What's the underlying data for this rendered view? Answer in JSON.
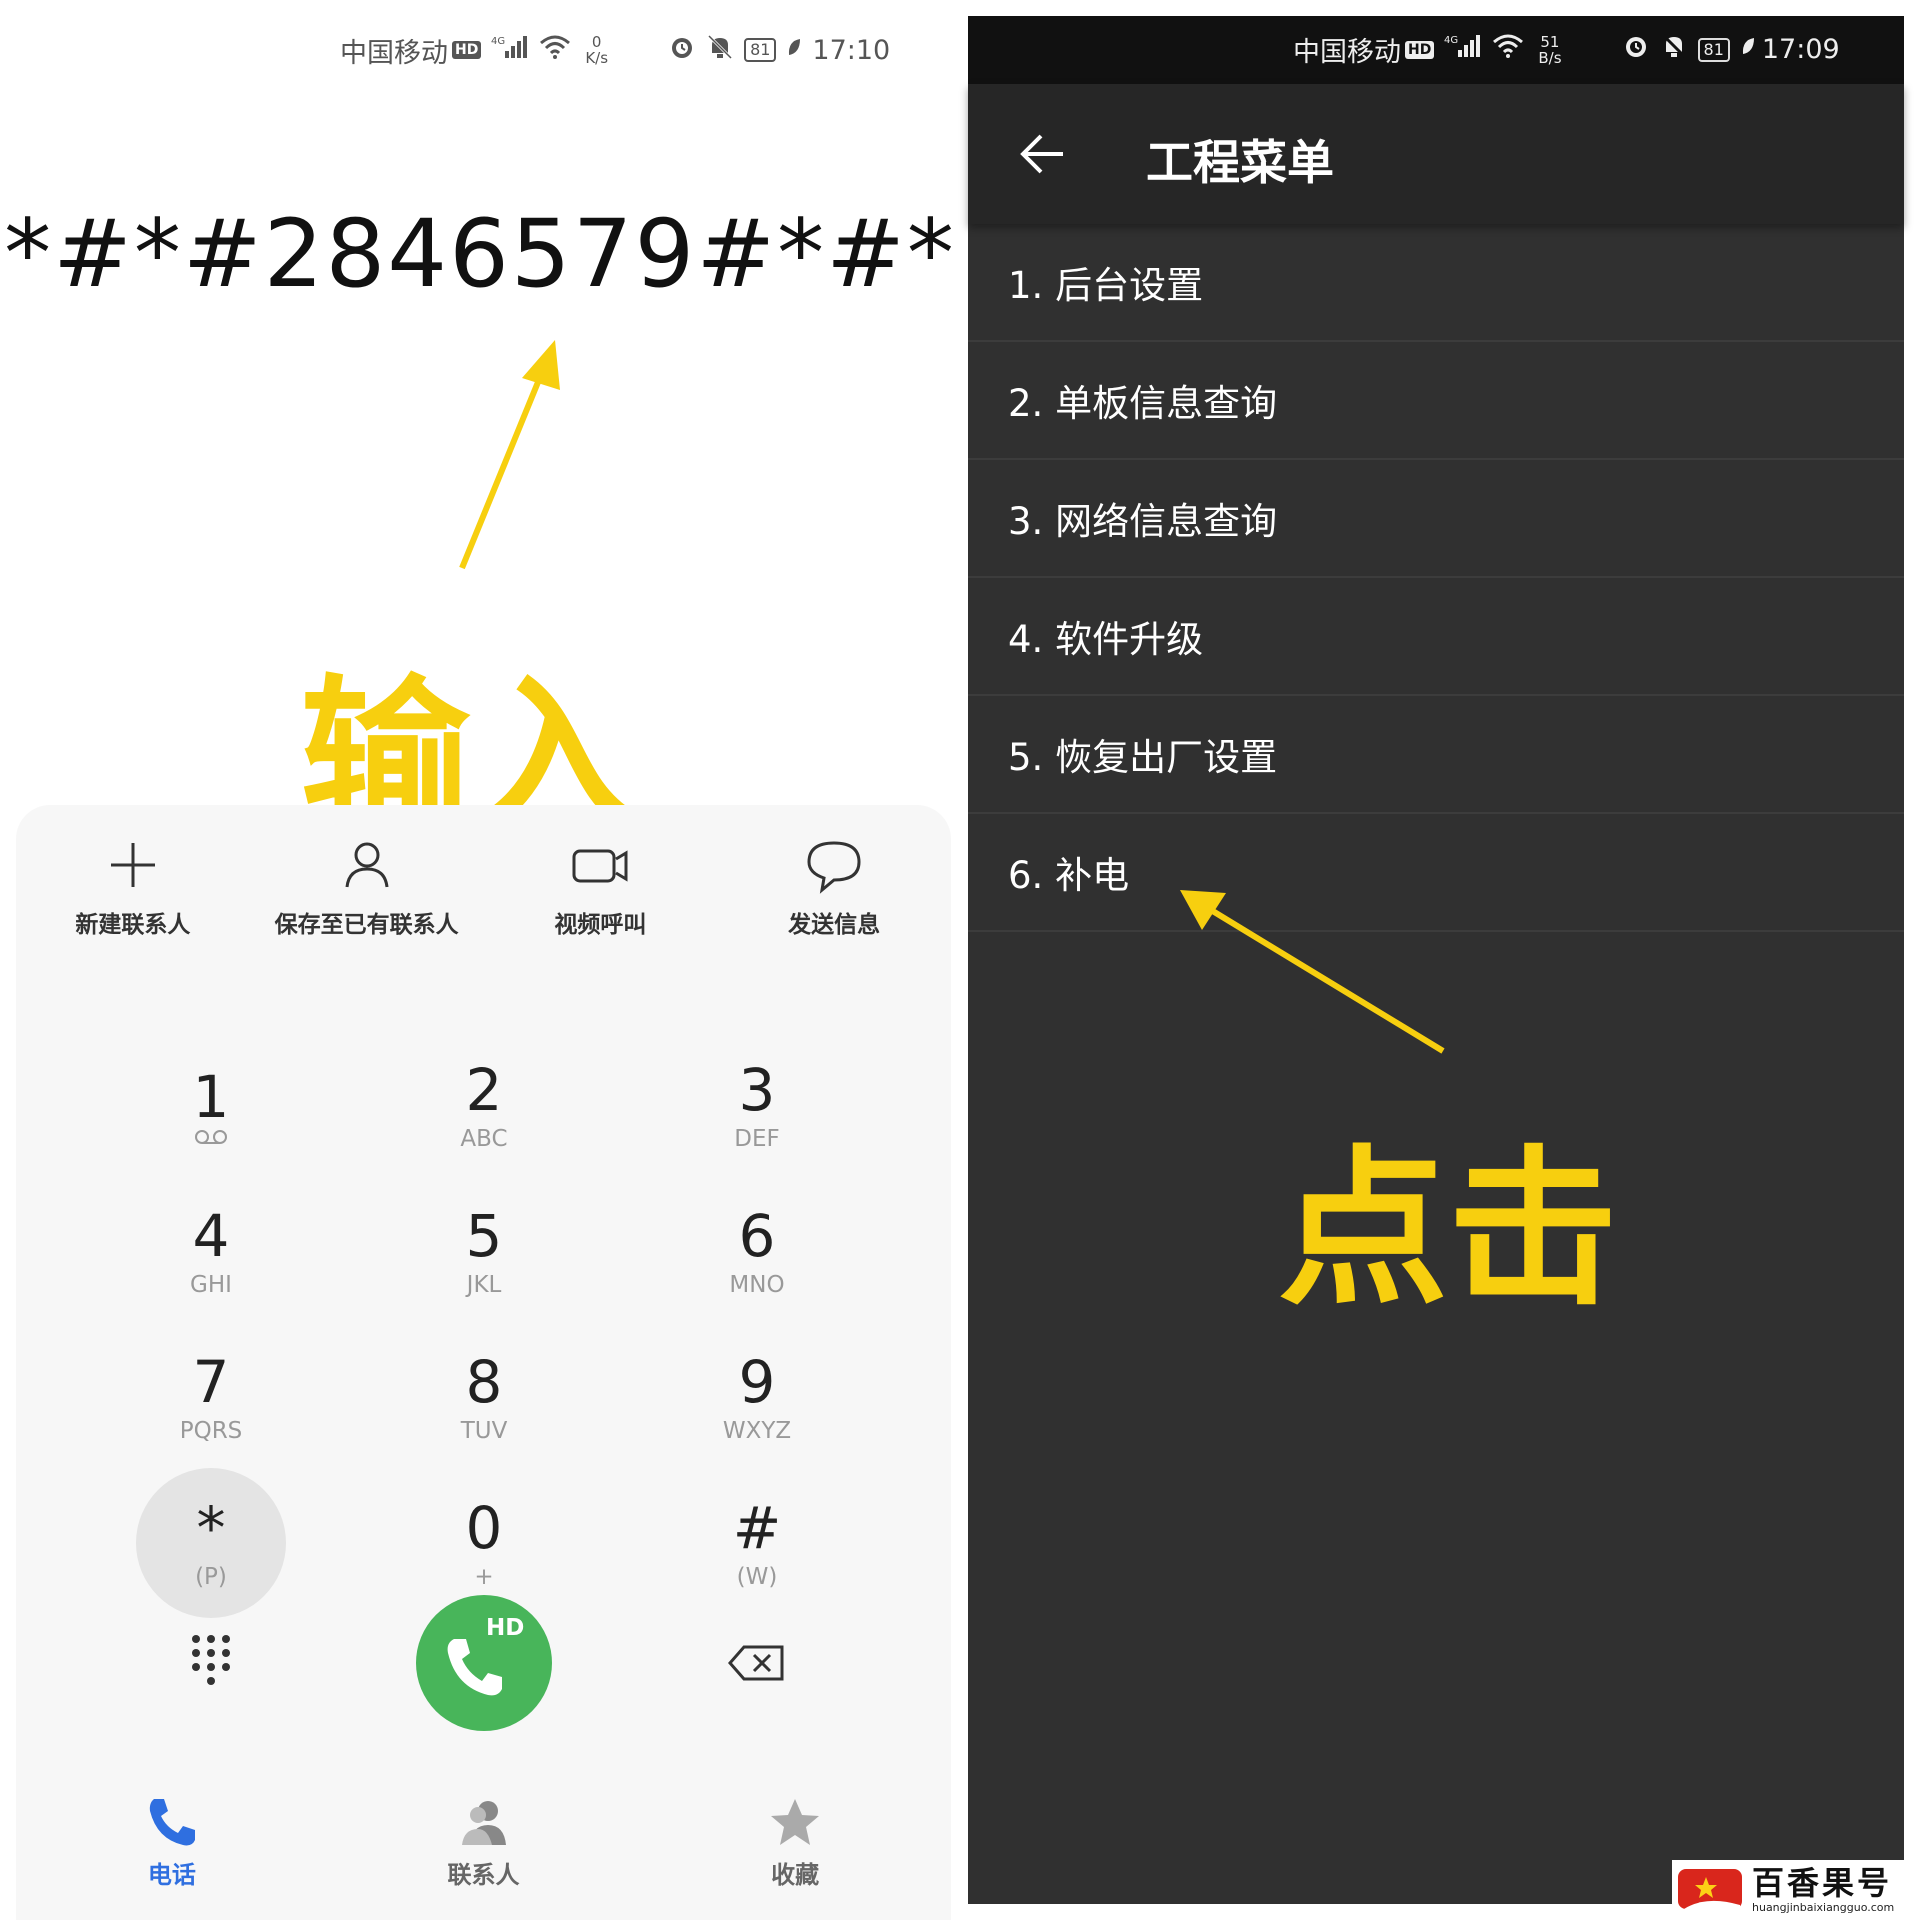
{
  "left_screen": {
    "status_bar": {
      "carrier": "中国移动",
      "hd": "HD",
      "network": "4G",
      "speed_value": "0",
      "speed_unit": "K/s",
      "battery": "81",
      "time": "17:10"
    },
    "dialed_number": "*#*#2846579#*#*",
    "annotation": "输入",
    "actions": [
      {
        "label": "新建联系人",
        "icon": "plus-icon"
      },
      {
        "label": "保存至已有联系人",
        "icon": "person-icon"
      },
      {
        "label": "视频呼叫",
        "icon": "video-camera-icon"
      },
      {
        "label": "发送信息",
        "icon": "chat-bubble-icon"
      }
    ],
    "keys": [
      {
        "num": "1",
        "sub": "voicemail"
      },
      {
        "num": "2",
        "sub": "ABC"
      },
      {
        "num": "3",
        "sub": "DEF"
      },
      {
        "num": "4",
        "sub": "GHI"
      },
      {
        "num": "5",
        "sub": "JKL"
      },
      {
        "num": "6",
        "sub": "MNO"
      },
      {
        "num": "7",
        "sub": "PQRS"
      },
      {
        "num": "8",
        "sub": "TUV"
      },
      {
        "num": "9",
        "sub": "WXYZ"
      },
      {
        "num": "*",
        "sub": "(P)"
      },
      {
        "num": "0",
        "sub": "+"
      },
      {
        "num": "#",
        "sub": "(W)"
      }
    ],
    "call_button_badge": "HD",
    "nav": [
      {
        "label": "电话",
        "icon": "phone-icon",
        "color": "#2f6fe0"
      },
      {
        "label": "联系人",
        "icon": "contacts-icon",
        "color": "#666666"
      },
      {
        "label": "收藏",
        "icon": "star-icon",
        "color": "#666666"
      }
    ],
    "colors": {
      "call_green": "#48b55a",
      "annotation_yellow": "#f7cf0f",
      "active_blue": "#2f6fe0"
    }
  },
  "right_screen": {
    "status_bar": {
      "carrier": "中国移动",
      "hd": "HD",
      "network": "4G",
      "speed_value": "51",
      "speed_unit": "B/s",
      "battery": "81",
      "time": "17:09"
    },
    "title": "工程菜单",
    "menu": [
      "1. 后台设置",
      "2. 单板信息查询",
      "3. 网络信息查询",
      "4. 软件升级",
      "5. 恢复出厂设置",
      "6. 补电"
    ],
    "annotation": "点击",
    "colors": {
      "background": "#303030",
      "appbar": "#262626"
    }
  },
  "watermark": {
    "title": "百香果号",
    "url": "huangjinbaixiangguo.com"
  }
}
